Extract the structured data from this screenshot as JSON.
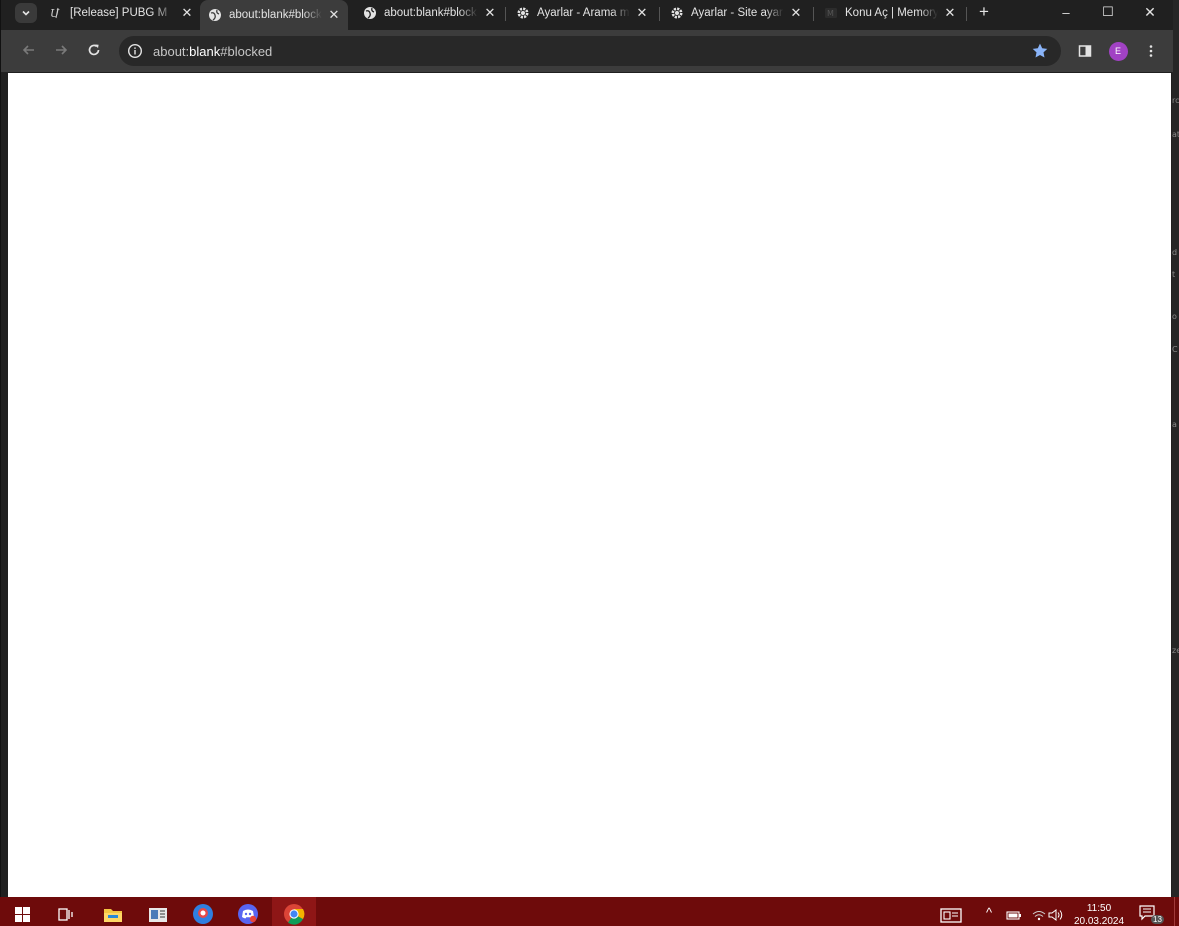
{
  "window": {
    "minimize_glyph": "–",
    "maximize_glyph": "☐",
    "close_glyph": "✕"
  },
  "tabs": [
    {
      "title": "[Release] PUBG M",
      "icon": "unknowncheats-icon",
      "active": false
    },
    {
      "title": "about:blank#block",
      "icon": "globe-icon",
      "active": true
    },
    {
      "title": "about:blank#block",
      "icon": "globe-icon",
      "active": false
    },
    {
      "title": "Ayarlar - Arama m",
      "icon": "gear-icon",
      "active": false
    },
    {
      "title": "Ayarlar - Site ayar",
      "icon": "gear-icon",
      "active": false
    },
    {
      "title": "Konu Aç | Memory",
      "icon": "memory-icon",
      "active": false
    }
  ],
  "tab_close_glyph": "✕",
  "new_tab_glyph": "+",
  "toolbar": {
    "url_prefix": "about:",
    "url_host": "blank",
    "url_suffix": "#blocked",
    "profile_initial": "E"
  },
  "taskbar": {
    "time": "11:50",
    "date": "20.03.2024",
    "notification_count": "13",
    "tray_chevron": "^",
    "apps": [
      "windows-start-icon",
      "task-view-icon",
      "file-explorer-icon",
      "news-icon",
      "search-globe-icon",
      "discord-icon",
      "chrome-icon"
    ]
  },
  "colors": {
    "taskbar": "#6e0b0b",
    "chrome_frame": "#202020",
    "toolbar": "#3c3c3c",
    "bookmark_star": "#8ab4f8",
    "avatar": "#a142c4"
  },
  "background_window_fragments": [
    "rc",
    "at",
    "d",
    "t",
    "o",
    "C",
    "a",
    "ze"
  ]
}
